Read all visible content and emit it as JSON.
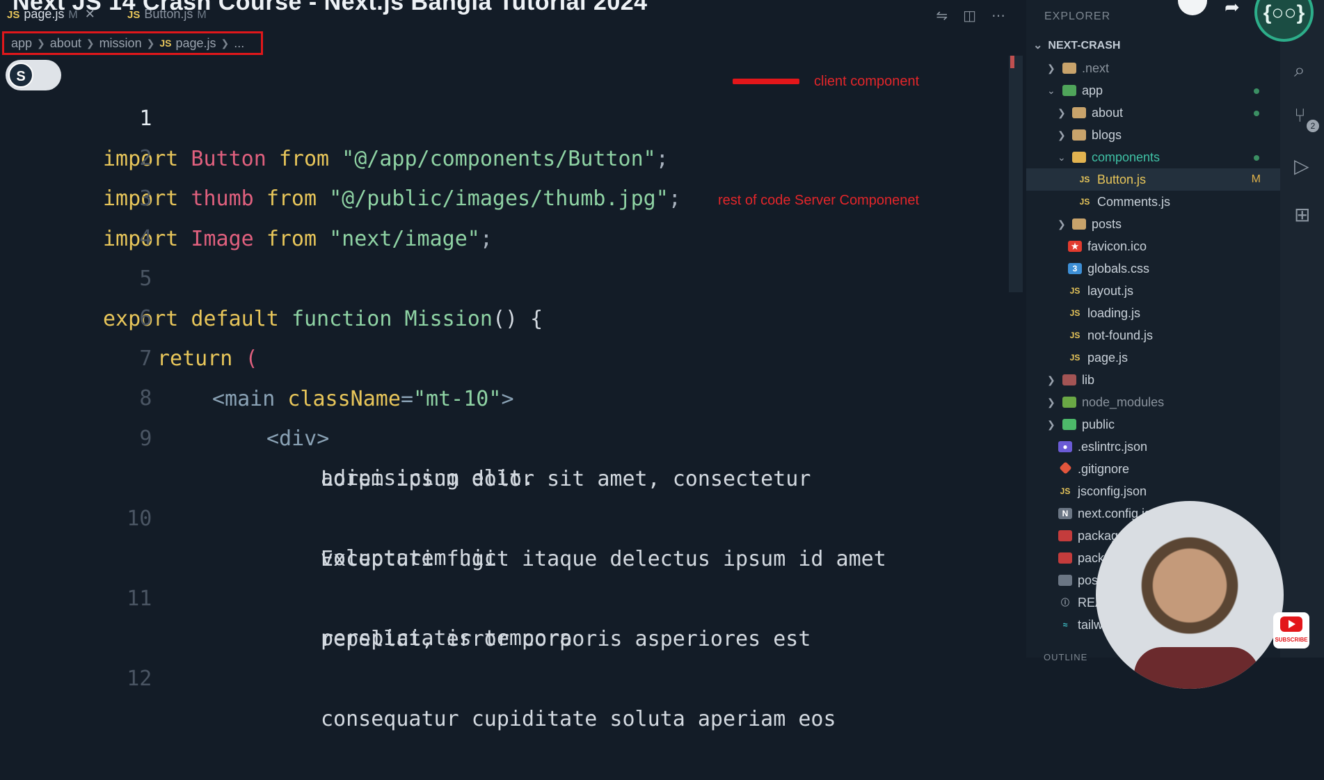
{
  "video_title": "Next JS 14 Crash Course - Next.js Bangla Tutorial 2024",
  "tabs": [
    {
      "icon": "JS",
      "label": "page.js",
      "modified": "M",
      "close": "✕"
    },
    {
      "icon": "JS",
      "label": "Button.js",
      "modified": "M"
    }
  ],
  "breadcrumb": [
    "app",
    "about",
    "mission",
    "page.js",
    "..."
  ],
  "breadcrumb_file_icon": "JS",
  "toggle_knob": "S",
  "code_lines": [
    {
      "n": "1",
      "parts": [
        "import",
        " Button ",
        "from",
        " \"@/app/components/Button\"",
        ";"
      ]
    },
    {
      "n": "2",
      "parts": [
        "import",
        " thumb ",
        "from",
        " \"@/public/images/thumb.jpg\"",
        ";"
      ]
    },
    {
      "n": "3",
      "parts": [
        "import",
        " Image ",
        "from",
        " \"next/image\"",
        ";"
      ]
    },
    {
      "n": "4"
    },
    {
      "n": "5",
      "parts": [
        "export default ",
        "function ",
        "Mission",
        "() {"
      ]
    },
    {
      "n": "6",
      "parts": [
        "return ",
        "("
      ]
    },
    {
      "n": "7",
      "parts": [
        "<main ",
        "className",
        "=",
        "\"mt-10\"",
        ">"
      ]
    },
    {
      "n": "8",
      "parts": [
        "<div>"
      ]
    },
    {
      "n": "9",
      "parts": [
        "Lorem ipsum dolor sit amet, consectetur",
        "adipisicing elit."
      ]
    },
    {
      "n": "10",
      "parts": [
        "Excepturi fugit itaque delectus ipsum id amet",
        "voluptatem hic"
      ]
    },
    {
      "n": "11",
      "parts": [
        "repellat, error corporis asperiores est",
        "perspiciatis tempora"
      ]
    },
    {
      "n": "12",
      "parts": [
        "consequatur cupiditate soluta aperiam eos"
      ]
    }
  ],
  "annotations": {
    "client": "client component",
    "server": "rest of code Server Componenet"
  },
  "explorer": {
    "header": "EXPLORER",
    "project": "NEXT-CRASH",
    "items": [
      {
        "label": ".next"
      },
      {
        "label": "app"
      },
      {
        "label": "about"
      },
      {
        "label": "blogs"
      },
      {
        "label": "components"
      },
      {
        "label": "Button.js",
        "badge": "M"
      },
      {
        "label": "Comments.js"
      },
      {
        "label": "posts"
      },
      {
        "label": "favicon.ico"
      },
      {
        "label": "globals.css"
      },
      {
        "label": "layout.js"
      },
      {
        "label": "loading.js"
      },
      {
        "label": "not-found.js"
      },
      {
        "label": "page.js"
      },
      {
        "label": "lib"
      },
      {
        "label": "node_modules"
      },
      {
        "label": "public"
      },
      {
        "label": ".eslintrc.json"
      },
      {
        "label": ".gitignore"
      },
      {
        "label": "jsconfig.json"
      },
      {
        "label": "next.config.js"
      },
      {
        "label": "package.json"
      },
      {
        "label": "package-lock.json"
      },
      {
        "label": "postcss.config.js"
      },
      {
        "label": "README.md"
      },
      {
        "label": "tailwind.config.js"
      }
    ],
    "outline": "OUTLINE"
  },
  "activity_badge": "2",
  "logo_text": "{○○}",
  "youtube_subscribe": "SUBSCRIBE",
  "colors": {
    "accent_red": "#e3161a",
    "keyword": "#e8c65a",
    "identifier": "#e0607e",
    "string": "#8fd3a4"
  }
}
